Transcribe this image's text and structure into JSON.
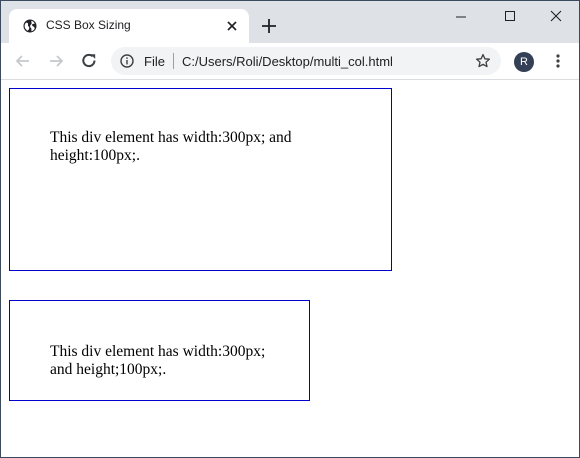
{
  "tab": {
    "title": "CSS Box Sizing"
  },
  "toolbar": {
    "scheme_label": "File",
    "url": "C:/Users/Roli/Desktop/multi_col.html",
    "avatar_letter": "R"
  },
  "page": {
    "box1_text": "This div element has width:300px; and height:100px;.",
    "box2_text": "This div element has width:300px; and height;100px;."
  },
  "icons": {
    "favicon": "globe-icon",
    "tab_close": "close-icon",
    "new_tab": "plus-icon",
    "minimize": "minimize-icon",
    "maximize": "maximize-icon",
    "window_close": "close-icon",
    "back": "arrow-left-icon",
    "forward": "arrow-right-icon",
    "reload": "reload-icon",
    "info": "info-icon",
    "bookmark": "star-icon",
    "menu": "kebab-menu-icon"
  },
  "colors": {
    "tabstrip_bg": "#dee1e6",
    "omnibox_bg": "#f1f3f4",
    "box_border": "#0000cc",
    "avatar_bg": "#344055"
  }
}
